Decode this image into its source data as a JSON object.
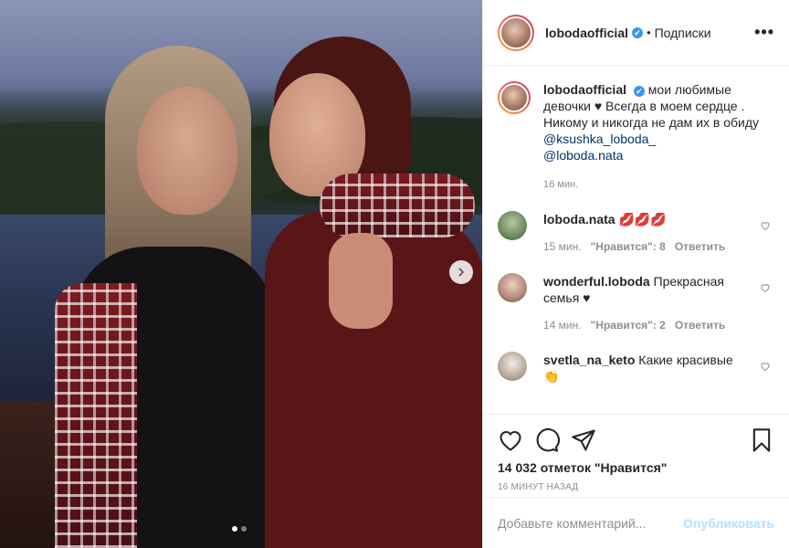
{
  "post": {
    "username": "lobodaofficial",
    "separator": "•",
    "follow_label": "Подписки",
    "more_label": "•••",
    "verified_mark": "✔",
    "caption_text": "мои любимые девочки ♥ Всегда в моем сердце . Никому и никогда не дам их в обиду",
    "mention_1": "@ksushka_loboda_",
    "mention_2": "@loboda.nata",
    "caption_time": "16 мин."
  },
  "comments": [
    {
      "user": "loboda.nata",
      "text": "💋💋💋",
      "time": "15 мин.",
      "likes": "\"Нравится\": 8",
      "reply": "Ответить"
    },
    {
      "user": "wonderful.loboda",
      "text": "Прекрасная семья ♥",
      "time": "14 мин.",
      "likes": "\"Нравится\": 2",
      "reply": "Ответить"
    },
    {
      "user": "svetla_na_keto",
      "text": "Какие красивые 👏"
    }
  ],
  "stats": {
    "likes_text": "14 032 отметок \"Нравится\"",
    "ago_text": "16 минут назад"
  },
  "compose": {
    "placeholder": "Добавьте комментарий...",
    "publish_label": "Опубликовать"
  },
  "carousel": {
    "current": 1,
    "total": 2
  },
  "colors": {
    "link": "#003569",
    "accent": "#3897f0",
    "publish_disabled": "#b2dffc",
    "muted": "#8e8e8e"
  },
  "icons": [
    "chevron-right-icon",
    "heart-icon",
    "comment-icon",
    "share-icon",
    "bookmark-icon",
    "verified-icon",
    "more-icon"
  ]
}
